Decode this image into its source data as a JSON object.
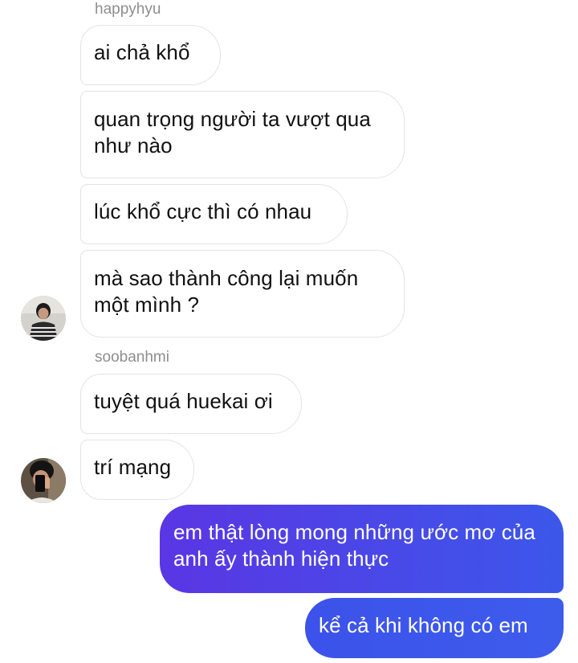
{
  "thread": {
    "groups": [
      {
        "sender": "happyhyu",
        "messages": [
          "ai chả khổ",
          "quan trọng người ta vượt qua như nào",
          "lúc khổ cực thì có nhau",
          "mà sao thành công lại muốn một mình ?"
        ],
        "avatar": "user-avatar-striped-sweater"
      },
      {
        "sender": "soobanhmi",
        "messages": [
          "tuyệt quá huekai ơi",
          "trí mạng"
        ],
        "avatar": "user-avatar-phone-selfie"
      }
    ],
    "outgoing": [
      "em thật lòng mong những ước mơ của anh ấy thành hiện thực",
      "kể cả khi không có em"
    ]
  },
  "colors": {
    "incoming_bg": "#ffffff",
    "incoming_border": "#e4e4e4",
    "incoming_text": "#111111",
    "outgoing_gradient_start": "#5a36e4",
    "outgoing_gradient_end": "#3c57ea",
    "outgoing_text": "#ffffff",
    "sender_name": "#8e8e8e"
  }
}
